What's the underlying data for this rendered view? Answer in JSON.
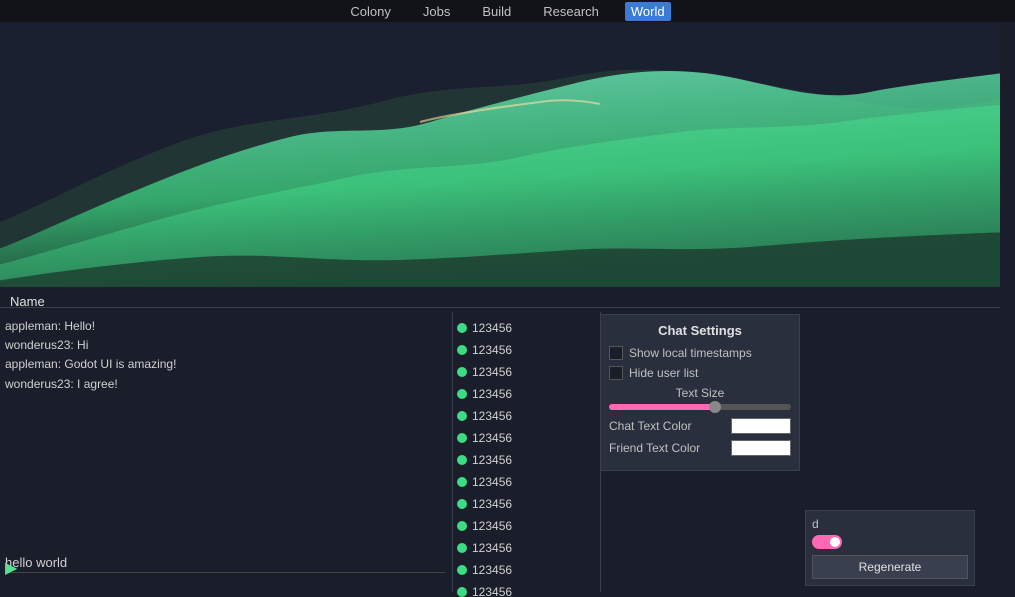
{
  "nav": {
    "items": [
      {
        "label": "Colony",
        "active": false
      },
      {
        "label": "Jobs",
        "active": false
      },
      {
        "label": "Build",
        "active": false
      },
      {
        "label": "Research",
        "active": false
      },
      {
        "label": "World",
        "active": true
      }
    ]
  },
  "name_label": "Name",
  "chat": {
    "messages": [
      "appleman: Hello!",
      "wonderus23: Hi",
      "appleman: Godot UI is amazing!",
      "wonderus23: I agree!"
    ],
    "input_value": "hello world",
    "input_placeholder": ""
  },
  "user_list": {
    "users": [
      "123456",
      "123456",
      "123456",
      "123456",
      "123456",
      "123456",
      "123456",
      "123456",
      "123456",
      "123456",
      "123456",
      "123456",
      "123456"
    ]
  },
  "chat_settings": {
    "title": "Chat Settings",
    "show_timestamps_label": "Show local timestamps",
    "hide_user_list_label": "Hide user list",
    "text_size_label": "Text Size",
    "chat_text_color_label": "Chat Text Color",
    "friend_text_color_label": "Friend Text Color",
    "slider_percent": 60
  },
  "right_panel": {
    "seed_label": "d",
    "regenerate_label": "Regenerate"
  }
}
